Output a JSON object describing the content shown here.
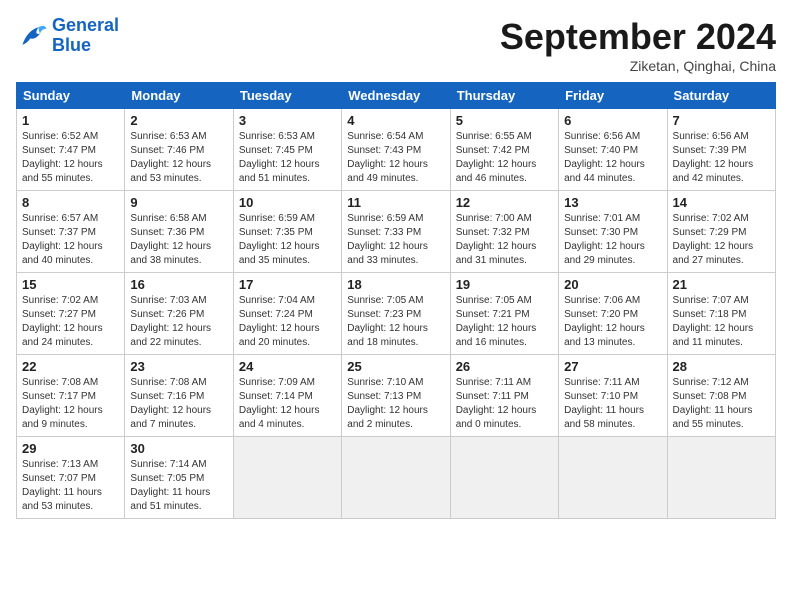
{
  "logo": {
    "line1": "General",
    "line2": "Blue"
  },
  "title": "September 2024",
  "subtitle": "Ziketan, Qinghai, China",
  "days_of_week": [
    "Sunday",
    "Monday",
    "Tuesday",
    "Wednesday",
    "Thursday",
    "Friday",
    "Saturday"
  ],
  "weeks": [
    [
      {
        "day": "1",
        "info": "Sunrise: 6:52 AM\nSunset: 7:47 PM\nDaylight: 12 hours\nand 55 minutes."
      },
      {
        "day": "2",
        "info": "Sunrise: 6:53 AM\nSunset: 7:46 PM\nDaylight: 12 hours\nand 53 minutes."
      },
      {
        "day": "3",
        "info": "Sunrise: 6:53 AM\nSunset: 7:45 PM\nDaylight: 12 hours\nand 51 minutes."
      },
      {
        "day": "4",
        "info": "Sunrise: 6:54 AM\nSunset: 7:43 PM\nDaylight: 12 hours\nand 49 minutes."
      },
      {
        "day": "5",
        "info": "Sunrise: 6:55 AM\nSunset: 7:42 PM\nDaylight: 12 hours\nand 46 minutes."
      },
      {
        "day": "6",
        "info": "Sunrise: 6:56 AM\nSunset: 7:40 PM\nDaylight: 12 hours\nand 44 minutes."
      },
      {
        "day": "7",
        "info": "Sunrise: 6:56 AM\nSunset: 7:39 PM\nDaylight: 12 hours\nand 42 minutes."
      }
    ],
    [
      {
        "day": "8",
        "info": "Sunrise: 6:57 AM\nSunset: 7:37 PM\nDaylight: 12 hours\nand 40 minutes."
      },
      {
        "day": "9",
        "info": "Sunrise: 6:58 AM\nSunset: 7:36 PM\nDaylight: 12 hours\nand 38 minutes."
      },
      {
        "day": "10",
        "info": "Sunrise: 6:59 AM\nSunset: 7:35 PM\nDaylight: 12 hours\nand 35 minutes."
      },
      {
        "day": "11",
        "info": "Sunrise: 6:59 AM\nSunset: 7:33 PM\nDaylight: 12 hours\nand 33 minutes."
      },
      {
        "day": "12",
        "info": "Sunrise: 7:00 AM\nSunset: 7:32 PM\nDaylight: 12 hours\nand 31 minutes."
      },
      {
        "day": "13",
        "info": "Sunrise: 7:01 AM\nSunset: 7:30 PM\nDaylight: 12 hours\nand 29 minutes."
      },
      {
        "day": "14",
        "info": "Sunrise: 7:02 AM\nSunset: 7:29 PM\nDaylight: 12 hours\nand 27 minutes."
      }
    ],
    [
      {
        "day": "15",
        "info": "Sunrise: 7:02 AM\nSunset: 7:27 PM\nDaylight: 12 hours\nand 24 minutes."
      },
      {
        "day": "16",
        "info": "Sunrise: 7:03 AM\nSunset: 7:26 PM\nDaylight: 12 hours\nand 22 minutes."
      },
      {
        "day": "17",
        "info": "Sunrise: 7:04 AM\nSunset: 7:24 PM\nDaylight: 12 hours\nand 20 minutes."
      },
      {
        "day": "18",
        "info": "Sunrise: 7:05 AM\nSunset: 7:23 PM\nDaylight: 12 hours\nand 18 minutes."
      },
      {
        "day": "19",
        "info": "Sunrise: 7:05 AM\nSunset: 7:21 PM\nDaylight: 12 hours\nand 16 minutes."
      },
      {
        "day": "20",
        "info": "Sunrise: 7:06 AM\nSunset: 7:20 PM\nDaylight: 12 hours\nand 13 minutes."
      },
      {
        "day": "21",
        "info": "Sunrise: 7:07 AM\nSunset: 7:18 PM\nDaylight: 12 hours\nand 11 minutes."
      }
    ],
    [
      {
        "day": "22",
        "info": "Sunrise: 7:08 AM\nSunset: 7:17 PM\nDaylight: 12 hours\nand 9 minutes."
      },
      {
        "day": "23",
        "info": "Sunrise: 7:08 AM\nSunset: 7:16 PM\nDaylight: 12 hours\nand 7 minutes."
      },
      {
        "day": "24",
        "info": "Sunrise: 7:09 AM\nSunset: 7:14 PM\nDaylight: 12 hours\nand 4 minutes."
      },
      {
        "day": "25",
        "info": "Sunrise: 7:10 AM\nSunset: 7:13 PM\nDaylight: 12 hours\nand 2 minutes."
      },
      {
        "day": "26",
        "info": "Sunrise: 7:11 AM\nSunset: 7:11 PM\nDaylight: 12 hours\nand 0 minutes."
      },
      {
        "day": "27",
        "info": "Sunrise: 7:11 AM\nSunset: 7:10 PM\nDaylight: 11 hours\nand 58 minutes."
      },
      {
        "day": "28",
        "info": "Sunrise: 7:12 AM\nSunset: 7:08 PM\nDaylight: 11 hours\nand 55 minutes."
      }
    ],
    [
      {
        "day": "29",
        "info": "Sunrise: 7:13 AM\nSunset: 7:07 PM\nDaylight: 11 hours\nand 53 minutes."
      },
      {
        "day": "30",
        "info": "Sunrise: 7:14 AM\nSunset: 7:05 PM\nDaylight: 11 hours\nand 51 minutes."
      },
      {
        "day": "",
        "info": ""
      },
      {
        "day": "",
        "info": ""
      },
      {
        "day": "",
        "info": ""
      },
      {
        "day": "",
        "info": ""
      },
      {
        "day": "",
        "info": ""
      }
    ]
  ]
}
